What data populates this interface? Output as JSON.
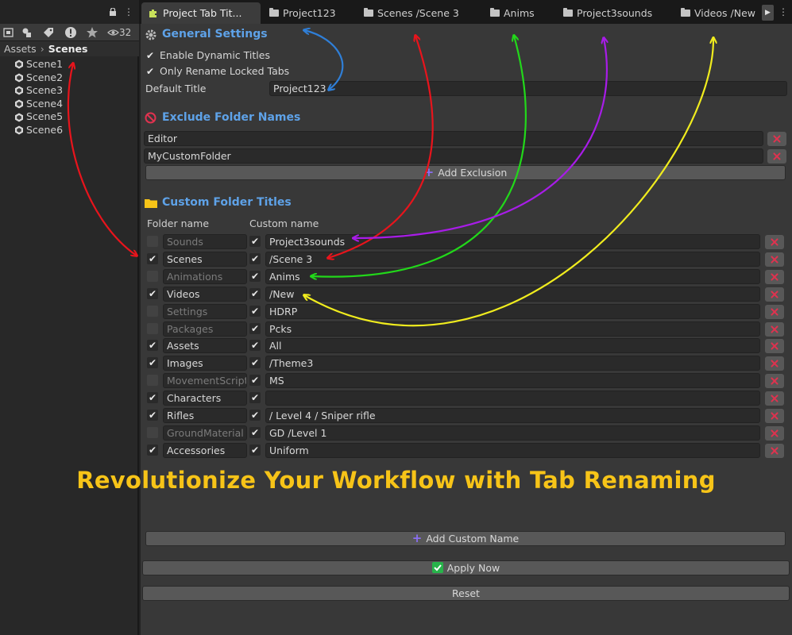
{
  "left_panel": {
    "hidden_count": "32",
    "breadcrumb": {
      "root": "Assets",
      "leaf": "Scenes"
    },
    "scenes": [
      "Scene1",
      "Scene2",
      "Scene3",
      "Scene4",
      "Scene5",
      "Scene6"
    ],
    "toolbar_icons": [
      "scene-filter-icon",
      "type-filter-icon",
      "label-filter-icon",
      "alert-icon",
      "favorite-star-icon",
      "eye-icon"
    ]
  },
  "tabs": [
    {
      "label": "Project Tab Tit...",
      "icon": "puzzle-icon",
      "active": true
    },
    {
      "label": "Project123",
      "icon": "folder-icon"
    },
    {
      "label": "Scenes /Scene 3",
      "icon": "folder-icon"
    },
    {
      "label": "Anims",
      "icon": "folder-icon"
    },
    {
      "label": "Project3sounds",
      "icon": "folder-icon"
    },
    {
      "label": "Videos /New",
      "icon": "folder-icon"
    }
  ],
  "general": {
    "title": "General Settings",
    "enable_dynamic_titles": "Enable Dynamic Titles",
    "only_rename_locked": "Only Rename Locked Tabs",
    "default_title_label": "Default Title",
    "default_title_value": "Project123"
  },
  "exclude": {
    "title": "Exclude Folder Names",
    "items": [
      "Editor",
      "MyCustomFolder"
    ],
    "add_label": "Add Exclusion"
  },
  "custom": {
    "title": "Custom Folder Titles",
    "col_folder": "Folder name",
    "col_custom": "Custom name",
    "rows": [
      {
        "folder": "Sounds",
        "enabled": false,
        "custom": "Project3sounds"
      },
      {
        "folder": "Scenes",
        "enabled": true,
        "custom": "/Scene 3"
      },
      {
        "folder": "Animations",
        "enabled": false,
        "custom": "Anims"
      },
      {
        "folder": "Videos",
        "enabled": true,
        "custom": "/New"
      },
      {
        "folder": "Settings",
        "enabled": false,
        "custom": "HDRP"
      },
      {
        "folder": "Packages",
        "enabled": false,
        "custom": "Pcks"
      },
      {
        "folder": "Assets",
        "enabled": true,
        "custom": "All"
      },
      {
        "folder": "Images",
        "enabled": true,
        "custom": "/Theme3"
      },
      {
        "folder": "MovementScript",
        "enabled": false,
        "custom": "MS"
      },
      {
        "folder": "Characters",
        "enabled": true,
        "custom": ""
      },
      {
        "folder": "Rifles",
        "enabled": true,
        "custom": "/ Level 4 / Sniper rifle"
      },
      {
        "folder": "GroundMaterial",
        "enabled": false,
        "custom": "GD /Level 1"
      },
      {
        "folder": "Accessories",
        "enabled": true,
        "custom": "Uniform"
      }
    ],
    "add_label": "Add Custom Name"
  },
  "apply_label": "Apply Now",
  "reset_label": "Reset",
  "banner": "Revolutionize Your Workflow with Tab Renaming",
  "colors": {
    "section_title": "#5ea2e8",
    "banner": "#f7c418",
    "delete": "#e0324f",
    "arrow_red": "#e8141c",
    "arrow_blue": "#2f7fd8",
    "arrow_green": "#22d81a",
    "arrow_purple": "#a81ce8",
    "arrow_yellow": "#f0ec1e"
  }
}
